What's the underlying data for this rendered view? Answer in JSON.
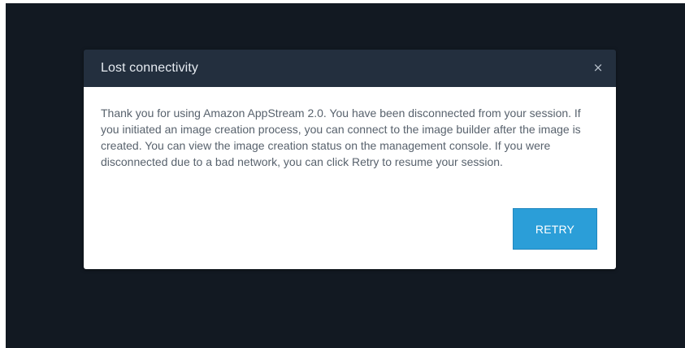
{
  "dialog": {
    "title": "Lost connectivity",
    "close_icon": "close-icon",
    "close_glyph": "×",
    "message": "Thank you for using Amazon AppStream 2.0. You have been disconnected from your session. If you initiated an image creation process, you can connect to the image builder after the image is created. You can view the image creation status on the management console. If you were disconnected due to a bad network, you can click Retry to resume your session.",
    "retry_label": "RETRY"
  },
  "colors": {
    "backdrop": "#121922",
    "header": "#232f3e",
    "accent": "#2b9ed8"
  }
}
